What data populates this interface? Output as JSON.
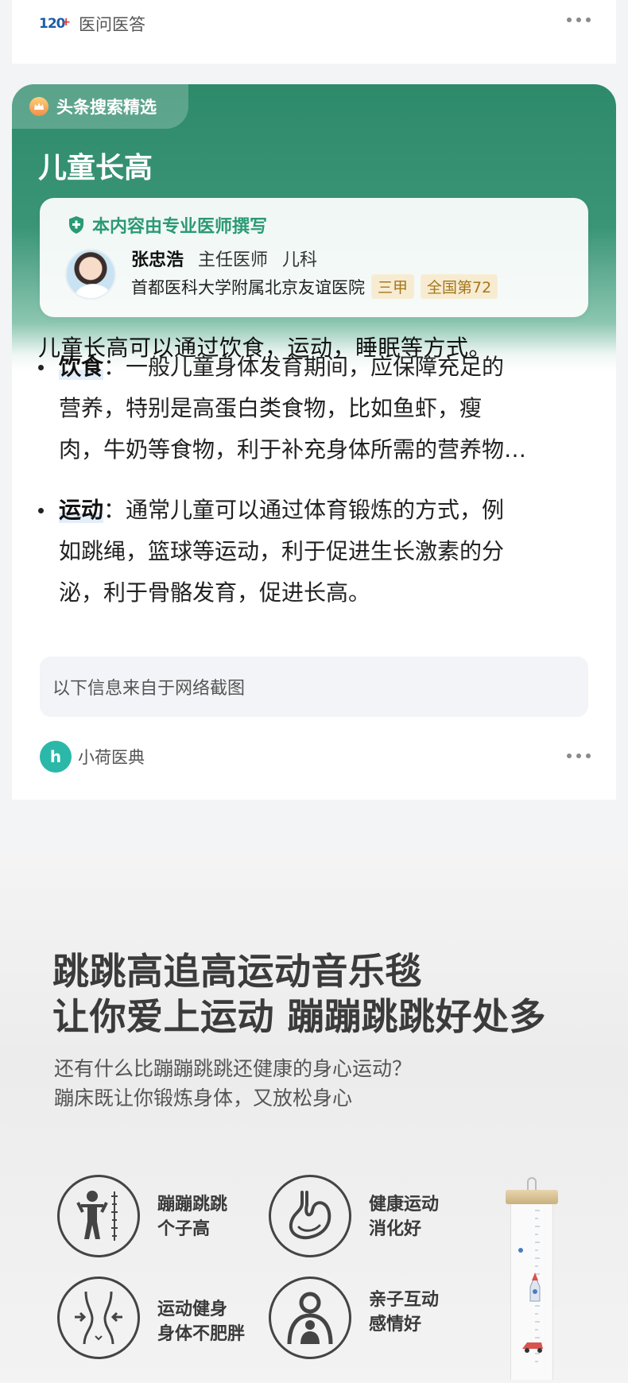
{
  "top_source": {
    "logo_text": "120",
    "logo_plus": "+",
    "name": "医问医答"
  },
  "card": {
    "tag": "头条搜索精选",
    "title": "儿童长高",
    "verify_text": "本内容由专业医师撰写",
    "doctor": {
      "name": "张忠浩",
      "title": "主任医师",
      "dept": "儿科",
      "hospital": "首都医科大学附属北京友谊医院",
      "badges": [
        "三甲",
        "全国第72"
      ]
    },
    "lead": "儿童长高可以通过饮食，运动，睡眠等方式。",
    "bullets": [
      {
        "keyword": "饮食",
        "lines": [
          "：一般儿童身体发育期间，应保障充足的",
          "营养，特别是高蛋白类食物，比如鱼虾，瘦",
          "肉，牛奶等食物，利于补充身体所需的营养物…"
        ]
      },
      {
        "keyword": "运动",
        "lines": [
          "：通常儿童可以通过体育锻炼的方式，例",
          "如跳绳，篮球等运动，利于促进生长激素的分",
          "泌，利于骨骼发育，促进长高。"
        ]
      }
    ],
    "note": "以下信息来自于网络截图",
    "source": {
      "logo_text": "h",
      "name": "小荷医典"
    }
  },
  "promo": {
    "headline": [
      "跳跳高追高运动音乐毯",
      "让你爱上运动 蹦蹦跳跳好处多"
    ],
    "subline": [
      "还有什么比蹦蹦跳跳还健康的身心运动？",
      "蹦床既让你锻炼身体，又放松身心"
    ],
    "features": [
      {
        "icon": "child-height-icon",
        "lines": [
          "蹦蹦跳跳",
          "个子高"
        ]
      },
      {
        "icon": "stomach-icon",
        "lines": [
          "健康运动",
          "消化好"
        ]
      },
      {
        "icon": "slim-body-icon",
        "lines": [
          "运动健身",
          "身体不肥胖"
        ]
      },
      {
        "icon": "parent-child-icon",
        "lines": [
          "亲子互动",
          "感情好"
        ]
      }
    ]
  },
  "colors": {
    "accent_green": "#2d8a6a",
    "verify_green": "#2b9a74",
    "badge_text": "#a5761c",
    "badge_bg": "#f7ecd2"
  }
}
